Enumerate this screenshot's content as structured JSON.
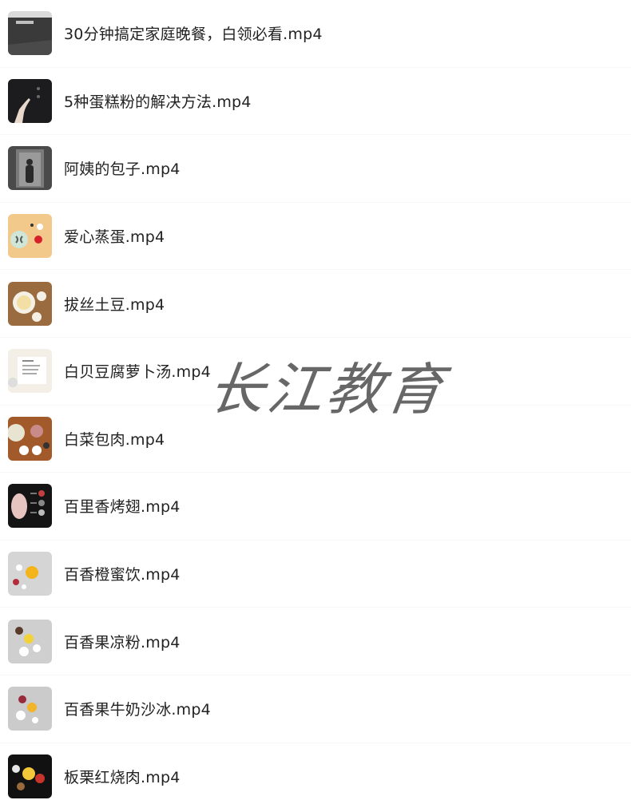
{
  "files": [
    {
      "name": "30分钟搞定家庭晚餐，白领必看.mp4",
      "thumb_icon": "laptop-video-thumbnail"
    },
    {
      "name": "5种蛋糕粉的解决方法.mp4",
      "thumb_icon": "dark-hand-video-thumbnail"
    },
    {
      "name": "阿姨的包子.mp4",
      "thumb_icon": "person-doorway-video-thumbnail"
    },
    {
      "name": "爱心蒸蛋.mp4",
      "thumb_icon": "steamed-egg-video-thumbnail"
    },
    {
      "name": "拔丝土豆.mp4",
      "thumb_icon": "potato-video-thumbnail"
    },
    {
      "name": "白贝豆腐萝卜汤.mp4",
      "thumb_icon": "recipe-card-video-thumbnail"
    },
    {
      "name": "白菜包肉.mp4",
      "thumb_icon": "cabbage-meat-video-thumbnail"
    },
    {
      "name": "百里香烤翅.mp4",
      "thumb_icon": "chicken-wings-video-thumbnail"
    },
    {
      "name": "百香橙蜜饮.mp4",
      "thumb_icon": "orange-drink-video-thumbnail"
    },
    {
      "name": "百香果凉粉.mp4",
      "thumb_icon": "jelly-video-thumbnail"
    },
    {
      "name": "百香果牛奶沙冰.mp4",
      "thumb_icon": "smoothie-video-thumbnail"
    },
    {
      "name": "板栗红烧肉.mp4",
      "thumb_icon": "braised-pork-video-thumbnail"
    }
  ],
  "watermark": "长江教育"
}
